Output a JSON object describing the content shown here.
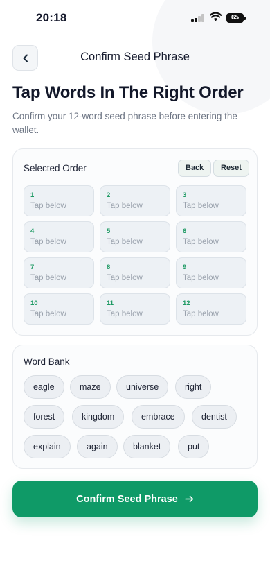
{
  "status_bar": {
    "time": "20:18",
    "battery": "65"
  },
  "header": {
    "title": "Confirm Seed Phrase"
  },
  "heading": "Tap Words In The Right Order",
  "subtitle": "Confirm your 12-word seed phrase before entering the wallet.",
  "selected_order": {
    "title": "Selected Order",
    "back_label": "Back",
    "reset_label": "Reset",
    "slots": [
      {
        "num": "1",
        "text": "Tap below"
      },
      {
        "num": "2",
        "text": "Tap below"
      },
      {
        "num": "3",
        "text": "Tap below"
      },
      {
        "num": "4",
        "text": "Tap below"
      },
      {
        "num": "5",
        "text": "Tap below"
      },
      {
        "num": "6",
        "text": "Tap below"
      },
      {
        "num": "7",
        "text": "Tap below"
      },
      {
        "num": "8",
        "text": "Tap below"
      },
      {
        "num": "9",
        "text": "Tap below"
      },
      {
        "num": "10",
        "text": "Tap below"
      },
      {
        "num": "11",
        "text": "Tap below"
      },
      {
        "num": "12",
        "text": "Tap below"
      }
    ]
  },
  "word_bank": {
    "title": "Word Bank",
    "words": [
      "eagle",
      "maze",
      "universe",
      "right",
      "forest",
      "kingdom",
      "embrace",
      "dentist",
      "explain",
      "again",
      "blanket",
      "put"
    ]
  },
  "confirm_button": {
    "label": "Confirm Seed Phrase",
    "icon": "arrow-right-icon"
  },
  "colors": {
    "accent": "#0f9a67",
    "slot_number": "#1f9a64"
  }
}
